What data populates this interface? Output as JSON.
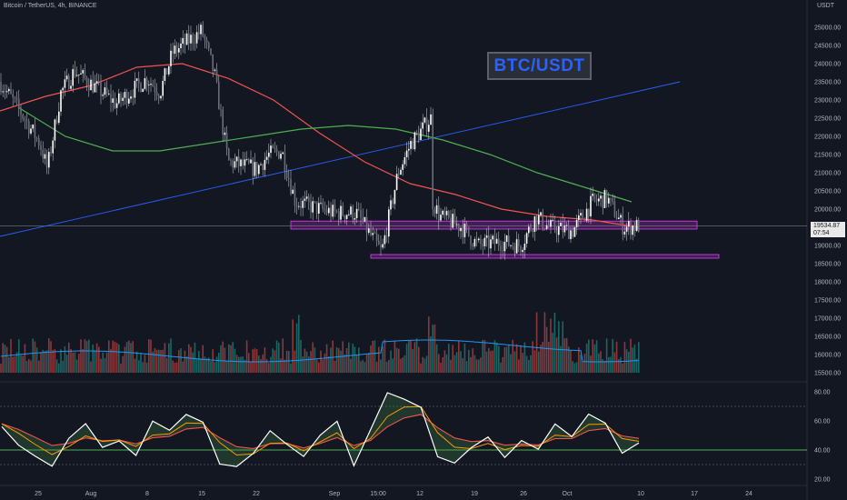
{
  "header": {
    "symbol_title": "Bitcoin / TetherUS, 4h, BINANCE",
    "axis_unit": "USDT"
  },
  "badge": {
    "label": "BTC/USDT"
  },
  "last_price": {
    "value": "19534.87",
    "countdown": "07:54"
  },
  "colors": {
    "background": "#131722",
    "candle_body": "#ffffff",
    "ma_fast": "#ef5350",
    "ma_slow": "#4caf50",
    "trendline": "#2962ff",
    "zone": "#e040fb",
    "volume_up": "#26a69a",
    "volume_down": "#ef5350",
    "volume_ma": "#2196f3",
    "osc_line": "#ffffff",
    "osc_signal": "#ff9800",
    "osc_slow": "#ef5350",
    "osc_level": "#4caf50"
  },
  "chart_data": [
    {
      "type": "candlestick",
      "title": "Bitcoin / TetherUS, 4h, BINANCE",
      "y_unit": "USDT",
      "ylim": [
        15000,
        25500
      ],
      "x_ticks": [
        "25",
        "Aug",
        "8",
        "15",
        "22",
        "Sep",
        "15:00",
        "12",
        "19",
        "26",
        "Oct",
        "10",
        "17",
        "24"
      ],
      "y_ticks": [
        "25000.00",
        "24500.00",
        "24000.00",
        "23500.00",
        "23000.00",
        "22500.00",
        "22000.00",
        "21500.00",
        "21000.00",
        "20500.00",
        "20000.00",
        "19500.00",
        "19000.00",
        "18500.00",
        "18000.00",
        "17500.00",
        "17000.00",
        "16500.00",
        "16000.00",
        "15500.00"
      ],
      "close_path_approx": [
        {
          "x": "Jul 19",
          "y": 23500
        },
        {
          "x": "Jul 22",
          "y": 22700
        },
        {
          "x": "Jul 25",
          "y": 21800
        },
        {
          "x": "Jul 26",
          "y": 21100
        },
        {
          "x": "Jul 28",
          "y": 23200
        },
        {
          "x": "Jul 30",
          "y": 23800
        },
        {
          "x": "Aug 3",
          "y": 23200
        },
        {
          "x": "Aug 5",
          "y": 22900
        },
        {
          "x": "Aug 8",
          "y": 23600
        },
        {
          "x": "Aug 10",
          "y": 23200
        },
        {
          "x": "Aug 12",
          "y": 24300
        },
        {
          "x": "Aug 15",
          "y": 24900
        },
        {
          "x": "Aug 17",
          "y": 23700
        },
        {
          "x": "Aug 19",
          "y": 21300
        },
        {
          "x": "Aug 22",
          "y": 21100
        },
        {
          "x": "Aug 24",
          "y": 21500
        },
        {
          "x": "Aug 26",
          "y": 21600
        },
        {
          "x": "Aug 28",
          "y": 20200
        },
        {
          "x": "Sep 1",
          "y": 19900
        },
        {
          "x": "Sep 4",
          "y": 19900
        },
        {
          "x": "Sep 6",
          "y": 18800
        },
        {
          "x": "Sep 8",
          "y": 21000
        },
        {
          "x": "Sep 10",
          "y": 21800
        },
        {
          "x": "Sep 13",
          "y": 22500
        },
        {
          "x": "Sep 13",
          "y": 20300
        },
        {
          "x": "Sep 15",
          "y": 19800
        },
        {
          "x": "Sep 18",
          "y": 19500
        },
        {
          "x": "Sep 20",
          "y": 19000
        },
        {
          "x": "Sep 23",
          "y": 19100
        },
        {
          "x": "Sep 26",
          "y": 19000
        },
        {
          "x": "Sep 28",
          "y": 19800
        },
        {
          "x": "Sep 30",
          "y": 19500
        },
        {
          "x": "Oct 2",
          "y": 19400
        },
        {
          "x": "Oct 4",
          "y": 20200
        },
        {
          "x": "Oct 6",
          "y": 20300
        },
        {
          "x": "Oct 8",
          "y": 19500
        },
        {
          "x": "Oct 9",
          "y": 19535
        }
      ],
      "series": [
        {
          "name": "",
          "kind": "moving-average-fast",
          "path_approx": [
            22700,
            23100,
            23400,
            23900,
            24000,
            23600,
            23000,
            22100,
            21300,
            20700,
            20400,
            20000,
            19800,
            19700,
            19500
          ]
        },
        {
          "name": "",
          "kind": "moving-average-slow",
          "path_approx": [
            22800,
            22000,
            21600,
            21600,
            21800,
            22000,
            22200,
            22300,
            22200,
            21900,
            21500,
            21000,
            20600,
            20200
          ]
        },
        {
          "name": "",
          "kind": "trendline",
          "points": [
            {
              "x": "Jul 19",
              "y": 19250
            },
            {
              "x": "Oct 16",
              "y": 23500
            }
          ]
        }
      ],
      "annotations": [
        {
          "kind": "zone",
          "y_range": [
            19450,
            19670
          ]
        },
        {
          "kind": "zone",
          "y_range": [
            18650,
            18750
          ]
        }
      ],
      "last_value": 19534.87
    },
    {
      "type": "bar",
      "kind": "volume",
      "note": "volume histogram at bottom of price pane with a blue moving average; values unlabeled"
    },
    {
      "type": "line",
      "kind": "oscillator",
      "ylim": [
        15,
        85
      ],
      "y_ticks": [
        "80.00",
        "60.00",
        "40.00",
        "20.00"
      ],
      "levels": [
        70,
        40,
        30
      ],
      "series": [
        {
          "name": "",
          "path_approx": [
            58,
            45,
            36,
            30,
            48,
            57,
            42,
            48,
            38,
            58,
            52,
            66,
            58,
            32,
            28,
            38,
            52,
            45,
            34,
            52,
            58,
            30,
            55,
            78,
            76,
            70,
            34,
            32,
            40,
            48,
            36,
            46,
            42,
            58,
            48,
            66,
            58,
            38,
            44
          ]
        }
      ]
    }
  ]
}
